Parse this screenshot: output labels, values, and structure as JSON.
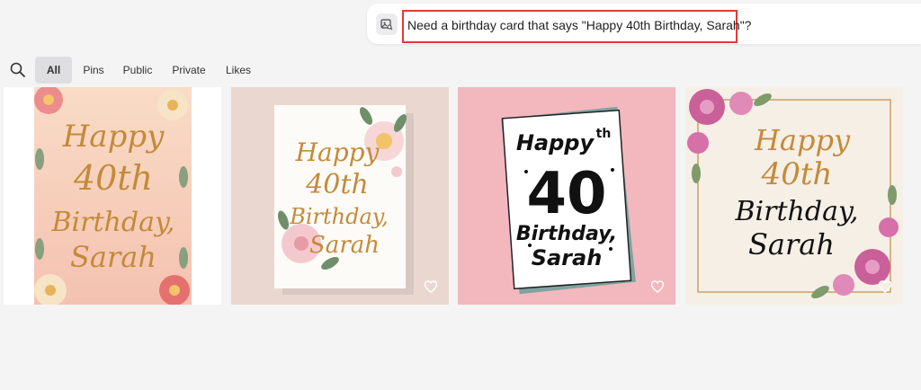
{
  "prompt": {
    "text": "Need a birthday card that says \"Happy 40th Birthday, Sarah\"?"
  },
  "filters": {
    "tabs": [
      {
        "label": "All",
        "active": true
      },
      {
        "label": "Pins",
        "active": false
      },
      {
        "label": "Public",
        "active": false
      },
      {
        "label": "Private",
        "active": false
      },
      {
        "label": "Likes",
        "active": false
      }
    ]
  },
  "cards": [
    {
      "lines": [
        "Happy",
        "40th",
        "Birthday,",
        "Sarah"
      ]
    },
    {
      "lines": [
        "Happy",
        "40th",
        "Birthday,",
        "Sarah"
      ]
    },
    {
      "lines": [
        "Happy",
        "th",
        "40",
        "Birthday,",
        "Sarah"
      ]
    },
    {
      "lines": [
        "Happy",
        "40th",
        "Birthday,",
        "Sarah"
      ]
    }
  ],
  "colors": {
    "highlight": "#e53935",
    "gold": "#c48a3a",
    "black": "#111111",
    "pink_bg": "#f2b8be"
  },
  "icons": [
    "image-search-icon",
    "search-icon",
    "heart-icon",
    "flower-icon"
  ]
}
